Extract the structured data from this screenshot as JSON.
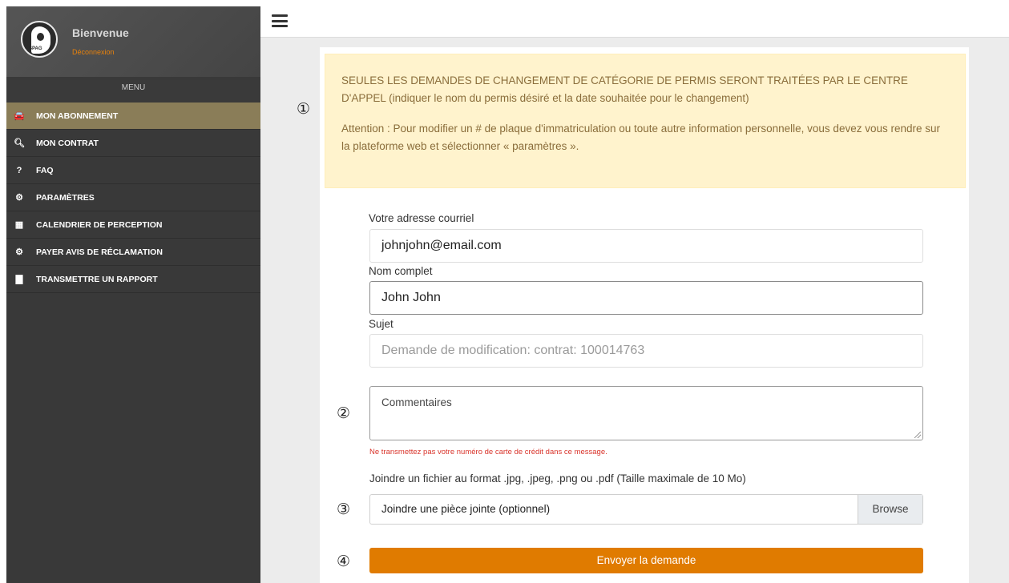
{
  "sidebar": {
    "logo_text": "SPAG",
    "welcome": "Bienvenue",
    "logout": "Déconnexion",
    "menu_label": "MENU",
    "items": [
      {
        "icon": "car-icon",
        "glyph": "🚘",
        "label": "MON ABONNEMENT",
        "active": true
      },
      {
        "icon": "search-icon",
        "glyph": "🔍︎",
        "label": "MON CONTRAT"
      },
      {
        "icon": "question-icon",
        "glyph": "?",
        "label": "FAQ"
      },
      {
        "icon": "gear-icon",
        "glyph": "⚙",
        "label": "PARAMÈTRES"
      },
      {
        "icon": "calendar-icon",
        "glyph": "▦",
        "label": "CALENDRIER DE PERCEPTION"
      },
      {
        "icon": "gear-icon",
        "glyph": "⚙",
        "label": "PAYER AVIS DE RÉCLAMATION"
      },
      {
        "icon": "document-icon",
        "glyph": "▇",
        "label": "TRANSMETTRE UN RAPPORT"
      }
    ]
  },
  "notice": {
    "line1": "SEULES LES DEMANDES DE CHANGEMENT DE CATÉGORIE DE PERMIS SERONT TRAITÉES PAR LE CENTRE D'APPEL (indiquer le nom du permis désiré et la date souhaitée pour le changement)",
    "line2": "Attention : Pour modifier un # de plaque d'immatriculation ou toute autre information personnelle, vous devez vous rendre sur la plateforme web et sélectionner « paramètres »."
  },
  "markers": [
    "①",
    "②",
    "③",
    "④"
  ],
  "form": {
    "email_label": "Votre adresse courriel",
    "email_value": "johnjohn@email.com",
    "name_label": "Nom complet",
    "name_value": "John John",
    "subject_label": "Sujet",
    "subject_placeholder": "Demande de modification: contrat: 100014763",
    "comments_placeholder": "Commentaires",
    "warning": "Ne transmettez pas votre numéro de carte de crédit dans ce message.",
    "file_hint": "Joindre un fichier au format .jpg, .jpeg, .png ou .pdf (Taille maximale de 10 Mo)",
    "file_placeholder": "Joindre une pièce jointe (optionnel)",
    "browse_label": "Browse",
    "submit_label": "Envoyer la demande"
  },
  "colors": {
    "accent": "#e07b00",
    "sidebar_bg": "#393939",
    "active_item": "#8a7d58",
    "notice_bg": "#fff3cd",
    "warning_text": "#d9342b"
  }
}
